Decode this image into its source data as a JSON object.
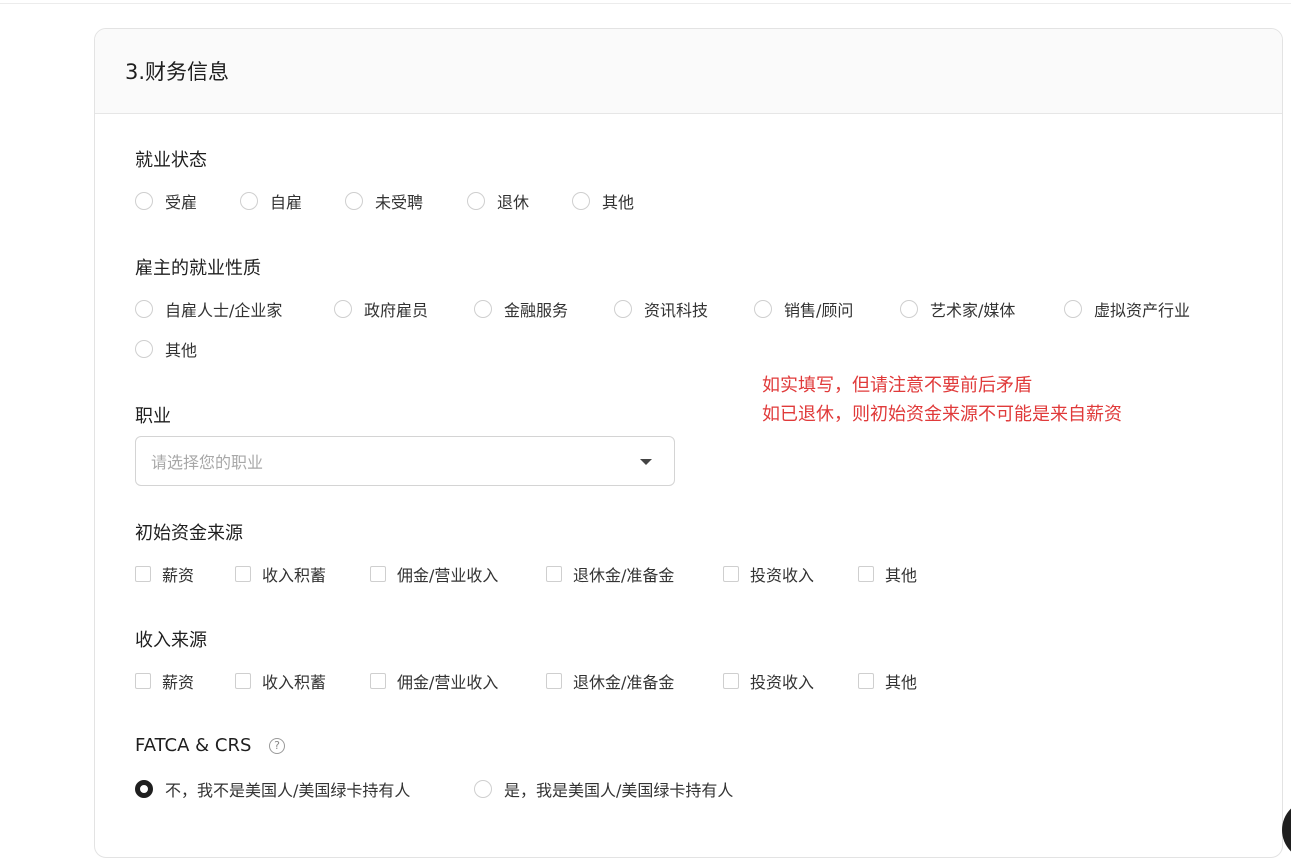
{
  "card": {
    "title": "3.财务信息"
  },
  "employment_status": {
    "label": "就业状态",
    "options": [
      "受雇",
      "自雇",
      "未受聘",
      "退休",
      "其他"
    ]
  },
  "employer_nature": {
    "label": "雇主的就业性质",
    "options": [
      "自雇人士/企业家",
      "政府雇员",
      "金融服务",
      "资讯科技",
      "销售/顾问",
      "艺术家/媒体",
      "虚拟资产行业",
      "其他"
    ]
  },
  "occupation": {
    "label": "职业",
    "placeholder": "请选择您的职业"
  },
  "hint": {
    "line1": "如实填写，但请注意不要前后矛盾",
    "line2": "如已退休，则初始资金来源不可能是来自薪资"
  },
  "initial_funds": {
    "label": "初始资金来源",
    "options": [
      "薪资",
      "收入积蓄",
      "佣金/营业收入",
      "退休金/准备金",
      "投资收入",
      "其他"
    ]
  },
  "income_source": {
    "label": "收入来源",
    "options": [
      "薪资",
      "收入积蓄",
      "佣金/营业收入",
      "退休金/准备金",
      "投资收入",
      "其他"
    ]
  },
  "fatca": {
    "label": "FATCA & CRS",
    "help_glyph": "?",
    "options": [
      "不，我不是美国人/美国绿卡持有人",
      "是，我是美国人/美国绿卡持有人"
    ],
    "selected_index": 0
  },
  "icons": {
    "help": "question-circle-icon",
    "dropdown": "caret-down-icon"
  },
  "colors": {
    "hint": "#e03a3a",
    "selected_radio": "#1f1f1f",
    "border": "#d4d4d4"
  }
}
